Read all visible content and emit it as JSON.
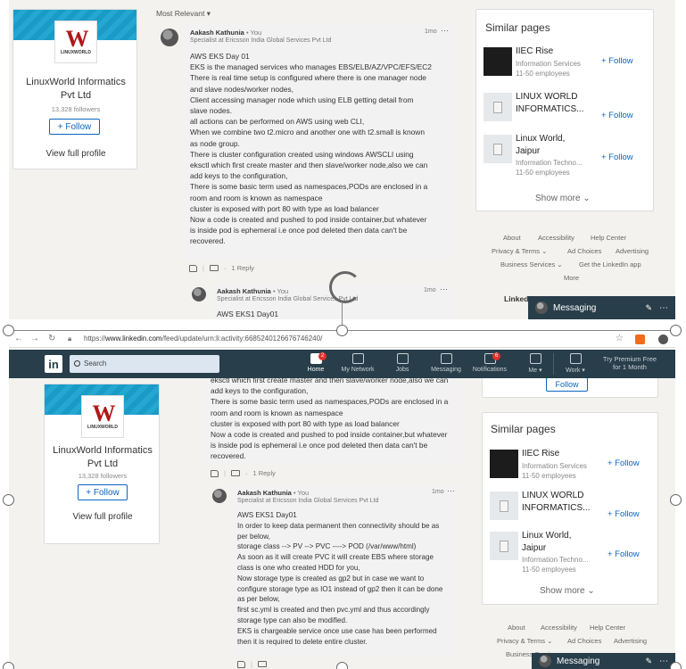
{
  "feed_sort": "Most Relevant",
  "company": {
    "name_line1": "LinuxWorld Informatics",
    "name_line2": "Pvt Ltd",
    "followers": "13,328 followers",
    "follow_label": "+ Follow",
    "view_profile": "View full profile",
    "logo_letter": "W",
    "logo_text": "LINUXWORLD"
  },
  "comment1": {
    "author": "Aakash Kathunia",
    "you": " • You",
    "headline": "Specialist at Ericsson India Global Services Pvt Ltd",
    "time": "1mo",
    "lines": [
      "AWS EKS Day 01",
      "EKS is the managed services who manages EBS/ELB/AZ/VPC/EFS/EC2",
      "There is real time setup is configured where there is one manager node",
      "and slave nodes/worker nodes,",
      "Client accessing manager node which using ELB getting detail from",
      "slave nodes.",
      "all actions can be performed on AWS using web CLI,",
      "When we combine two t2.micro and another one with t2.small is known",
      "as node group.",
      "There is cluster configuration created using windows AWSCLI using",
      "eksctl which first create master and then slave/worker node,also we can",
      "add keys to the configuration,",
      "There is some basic term used as namespaces,PODs are enclosed in a",
      "room and room is known as namespace",
      "cluster is exposed with port 80 with type as load balancer",
      "Now a code is created and pushed to pod inside container,but whatever",
      "is inside pod is ephemeral i.e once pod deleted then data can't be",
      "recovered."
    ],
    "reply_count": "1 Reply"
  },
  "comment1_tail": [
    "eksctl which first create master and then slave/worker node,also we can",
    "add keys to the configuration,",
    "There is some basic term used as namespaces,PODs are enclosed in a",
    "room and room is known as namespace",
    "cluster is exposed with port 80 with type as load balancer",
    "Now a code is created and pushed to pod inside container,but whatever",
    "is inside pod is ephemeral i.e once pod deleted then data can't be",
    "recovered."
  ],
  "comment2": {
    "author": "Aakash Kathunia",
    "you": " • You",
    "headline": "Specialist at Ericsson India Global Services Pvt Ltd",
    "time": "1mo",
    "preview_line": "AWS EKS1 Day01",
    "lines": [
      "AWS EKS1 Day01",
      "In order to keep data permanent then connectivity should be as",
      "per below,",
      "storage class --> PV --> PVC ----> POD (/var/www/html)",
      "As soon as it will create PVC it will create EBS where storage",
      "class is one who created HDD for you,",
      "Now storage type is created as gp2 but in case we want to",
      "configure storage type as IO1 instead of gp2 then it can be done",
      "as per below,",
      "first sc.yml is created and then pvc.yml and thus accordingly",
      "storage type can also be modified.",
      "EKS is chargeable service once use case has been performed",
      "then it is required to delete entire cluster."
    ]
  },
  "similar_pages": {
    "title": "Similar pages",
    "follow_label": "+ Follow",
    "show_more": "Show more",
    "items": [
      {
        "name1": "IIEC Rise",
        "name2": "",
        "meta1": "Information Services",
        "meta2": "11-50 employees",
        "logo": "dark"
      },
      {
        "name1": "LINUX WORLD",
        "name2": "INFORMATICS...",
        "meta1": "",
        "meta2": "",
        "logo": "placeholder"
      },
      {
        "name1": "Linux World,",
        "name2": "Jaipur",
        "meta1": "Information Techno...",
        "meta2": "11-50 employees",
        "logo": "placeholder"
      }
    ]
  },
  "top_follow_label": "Follow",
  "footer": {
    "about": "About",
    "accessibility": "Accessibility",
    "help": "Help Center",
    "privacy": "Privacy & Terms",
    "ad_choices": "Ad Choices",
    "advertising": "Advertising",
    "business": "Business Services",
    "app": "Get the LinkedIn app",
    "more": "More",
    "linkedin_partial": "Linked"
  },
  "messaging": {
    "label": "Messaging"
  },
  "browser": {
    "url_prefix": "https://",
    "url_main": "www.linkedin.com",
    "url_rest": "/feed/update/urn:li:activity:6685240126676746240/"
  },
  "nav": {
    "search_placeholder": "Search",
    "items": [
      {
        "label": "Home",
        "badge": "2"
      },
      {
        "label": "My Network",
        "badge": ""
      },
      {
        "label": "Jobs",
        "badge": ""
      },
      {
        "label": "Messaging",
        "badge": ""
      },
      {
        "label": "Notifications",
        "badge": "6"
      },
      {
        "label": "Me ▾",
        "badge": ""
      },
      {
        "label": "Work ▾",
        "badge": ""
      }
    ],
    "premium_line1": "Try Premium Free",
    "premium_line2": "for 1 Month"
  },
  "colors": {
    "accent": "#0a66c2",
    "nav_bg": "#283e4a",
    "page_bg": "#f3f2ef"
  }
}
